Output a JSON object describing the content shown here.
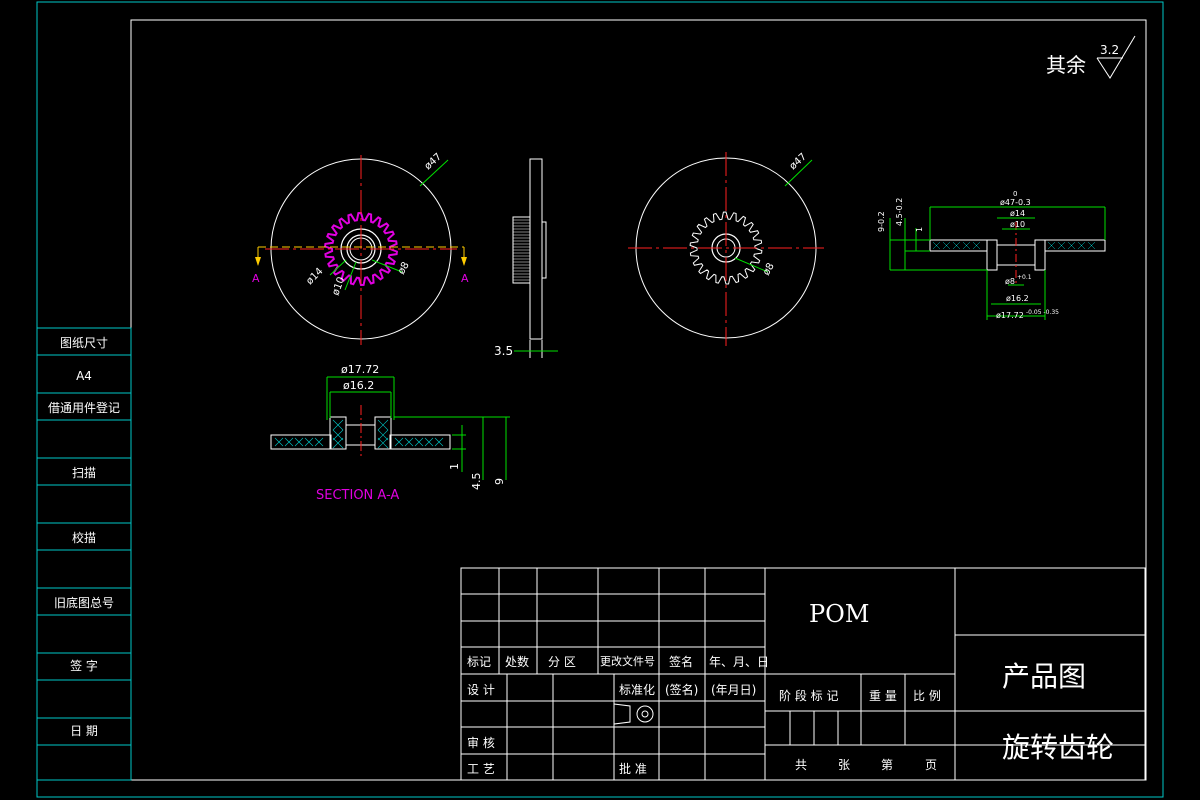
{
  "surface_note": {
    "prefix": "其余",
    "value": "3.2"
  },
  "dims_front": {
    "d47": "ø47",
    "d14": "ø14",
    "d10": "ø10",
    "d8": "ø8",
    "section_mark": "A"
  },
  "dims_back": {
    "d47": "ø47",
    "d8": "ø8"
  },
  "dims_side": {
    "thick": "3.5"
  },
  "section": {
    "title": "SECTION A-A",
    "d1772": "ø17.72",
    "d162": "ø16.2",
    "h1": "1",
    "h45": "4.5",
    "h9": "9"
  },
  "right_section": {
    "top_tol": "0",
    "d47": "ø47-0.3",
    "d14": "ø14",
    "d10": "ø10",
    "d8": "ø8",
    "d8tol": "+0.1",
    "d162": "ø16.2",
    "d1772": "ø17.72",
    "d1772tol": "-0.05 -0.35",
    "h9": "9-0.2",
    "h45": "4.5-0.2",
    "h1": "1"
  },
  "left_strip": {
    "items": [
      "图纸尺寸",
      "A4",
      "借通用件登记",
      "扫描",
      "校描",
      "旧底图总号",
      "签 字",
      "日 期"
    ]
  },
  "title_block": {
    "material": "POM",
    "drawing_type": "产品图",
    "part_name": "旋转齿轮",
    "row_header": [
      "标记",
      "处数",
      "分 区",
      "更改文件号",
      "签名",
      "年、月、日"
    ],
    "design": "设 计",
    "standardize": "标准化",
    "sign": "(签名)",
    "date": "(年月日)",
    "stage": "阶 段 标 记",
    "weight": "重 量",
    "scale": "比 例",
    "review": "审 核",
    "process": "工 艺",
    "approve": "批 准",
    "sheets": [
      "共",
      "张",
      "第",
      "页"
    ]
  }
}
